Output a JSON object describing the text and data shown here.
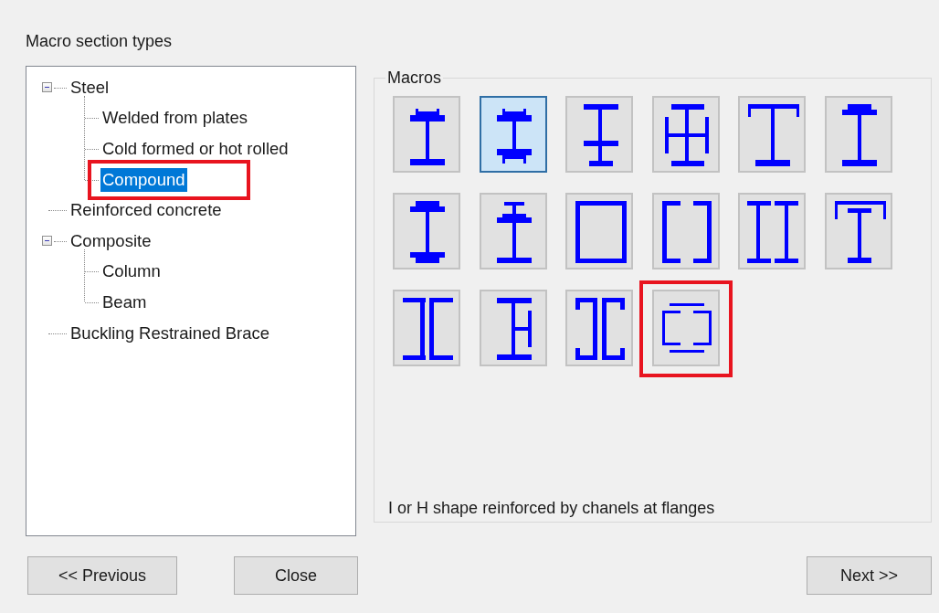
{
  "heading": "Macro section types",
  "tree": [
    {
      "label": "Steel",
      "expanded": true,
      "selected": false,
      "children": [
        {
          "label": "Welded from plates",
          "selected": false
        },
        {
          "label": "Cold formed or hot rolled",
          "selected": false
        },
        {
          "label": "Compound",
          "selected": true,
          "highlighted": true
        }
      ]
    },
    {
      "label": "Reinforced concrete",
      "selected": false
    },
    {
      "label": "Composite",
      "expanded": true,
      "selected": false,
      "children": [
        {
          "label": "Column",
          "selected": false
        },
        {
          "label": "Beam",
          "selected": false
        }
      ]
    },
    {
      "label": "Buckling Restrained Brace",
      "selected": false
    }
  ],
  "macros": {
    "title": "Macros",
    "items": [
      {
        "kind": "channeltop",
        "selected": false
      },
      {
        "kind": "twochannels",
        "selected": true
      },
      {
        "kind": "doubleflange",
        "selected": false
      },
      {
        "kind": "cross",
        "selected": false
      },
      {
        "kind": "tcover",
        "selected": false
      },
      {
        "kind": "covertop",
        "selected": false
      },
      {
        "kind": "coverboth",
        "selected": false
      },
      {
        "kind": "offset",
        "selected": false
      },
      {
        "kind": "box",
        "selected": false
      },
      {
        "kind": "facing",
        "selected": false
      },
      {
        "kind": "twoi",
        "selected": false
      },
      {
        "kind": "tchannel",
        "selected": false
      },
      {
        "kind": "backtoback",
        "selected": false
      },
      {
        "kind": "sidechannel",
        "selected": false
      },
      {
        "kind": "outward",
        "selected": false
      },
      {
        "kind": "flangechannels",
        "selected": false,
        "highlighted": true
      }
    ],
    "description": "I or H shape reinforced by chanels at flanges"
  },
  "buttons": {
    "previous": "<< Previous",
    "close": "Close",
    "next": "Next >>"
  }
}
